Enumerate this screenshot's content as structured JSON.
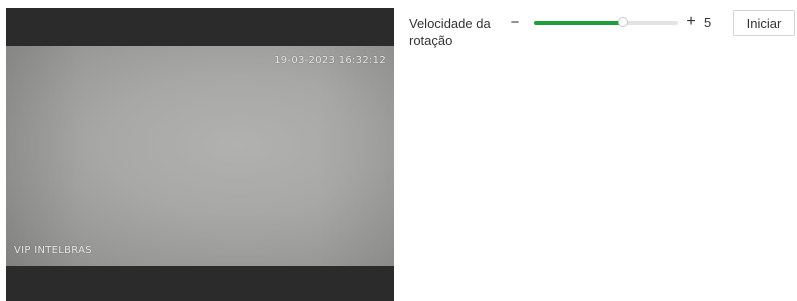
{
  "video": {
    "timestamp": "19-03-2023 16:32:12",
    "brand": "VIP INTELBRAS"
  },
  "rotation": {
    "label": "Velocidade da rotação",
    "minus": "−",
    "plus": "+",
    "value": "5",
    "level_fraction": 0.62,
    "accent_color": "#1f9e3a"
  },
  "actions": {
    "start_label": "Iniciar"
  }
}
